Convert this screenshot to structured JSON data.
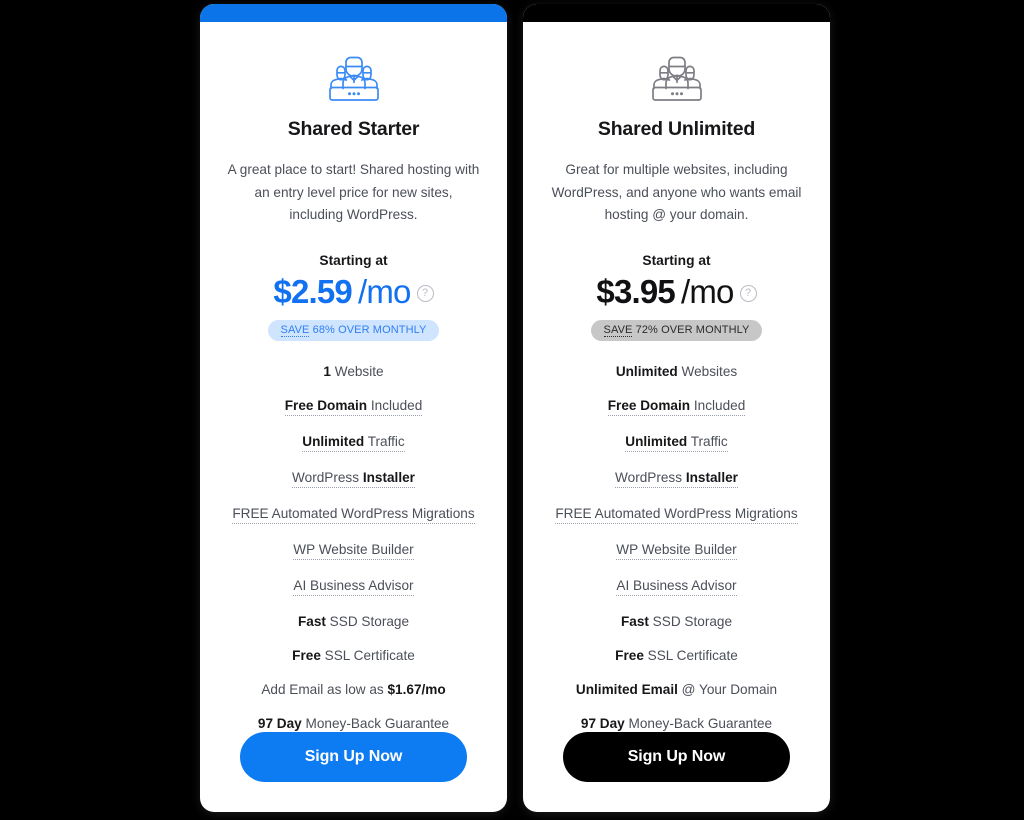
{
  "background_color": "#000000",
  "plans": [
    {
      "accent_color": "#1271f0",
      "topbar_color": "#0a74e8",
      "icon_name": "team-support-icon",
      "title": "Shared Starter",
      "description": "A great place to start! Shared hosting with an entry level price for new sites, including WordPress.",
      "starting_at_label": "Starting at",
      "price_amount": "$2.59",
      "price_period": "/mo",
      "help_icon": "question-mark-circle-icon",
      "save_badge": {
        "save_word": "SAVE",
        "rest": " 68% OVER MONTHLY",
        "background": "#cfe4ff",
        "text_color": "#2f7ff3"
      },
      "features": [
        {
          "bold": "1",
          "normal": " Website",
          "tooltip": false
        },
        {
          "bold": "Free Domain",
          "normal": " Included",
          "tooltip": true
        },
        {
          "bold": "Unlimited",
          "normal": " Traffic",
          "tooltip": true
        },
        {
          "bold": "",
          "normal": "WordPress ",
          "bold_after": "Installer",
          "tooltip": true
        },
        {
          "bold": "",
          "normal": "FREE Automated WordPress Migrations",
          "tooltip": true
        },
        {
          "bold": "",
          "normal": "WP Website Builder",
          "tooltip": true
        },
        {
          "bold": "",
          "normal": "AI Business Advisor",
          "tooltip": true
        },
        {
          "bold": "Fast",
          "normal": " SSD Storage",
          "tooltip": false
        },
        {
          "bold": "Free",
          "normal": " SSL Certificate",
          "tooltip": false
        },
        {
          "bold": "",
          "normal": "Add Email as low as ",
          "bold_after": "$1.67/mo",
          "tooltip": false
        },
        {
          "bold": "97 Day",
          "normal": " Money-Back Guarantee",
          "tooltip": false
        }
      ],
      "cta_label": "Sign Up Now",
      "cta_color": "#0d7bf2"
    },
    {
      "accent_color": "#111114",
      "topbar_color": "#000000",
      "icon_name": "team-support-icon",
      "title": "Shared Unlimited",
      "description": "Great for multiple websites, including WordPress, and anyone who wants email hosting @ your domain.",
      "starting_at_label": "Starting at",
      "price_amount": "$3.95",
      "price_period": "/mo",
      "help_icon": "question-mark-circle-icon",
      "save_badge": {
        "save_word": "SAVE",
        "rest": " 72% OVER MONTHLY",
        "background": "#c7c7c7",
        "text_color": "#2b2b2e"
      },
      "features": [
        {
          "bold": "Unlimited",
          "normal": " Websites",
          "tooltip": false
        },
        {
          "bold": "Free Domain",
          "normal": " Included",
          "tooltip": true
        },
        {
          "bold": "Unlimited",
          "normal": " Traffic",
          "tooltip": true
        },
        {
          "bold": "",
          "normal": "WordPress ",
          "bold_after": "Installer",
          "tooltip": true
        },
        {
          "bold": "",
          "normal": "FREE Automated WordPress Migrations",
          "tooltip": true
        },
        {
          "bold": "",
          "normal": "WP Website Builder",
          "tooltip": true
        },
        {
          "bold": "",
          "normal": "AI Business Advisor",
          "tooltip": true
        },
        {
          "bold": "Fast",
          "normal": " SSD Storage",
          "tooltip": false
        },
        {
          "bold": "Free",
          "normal": " SSL Certificate",
          "tooltip": false
        },
        {
          "bold": "Unlimited Email",
          "normal": " @ Your Domain",
          "tooltip": false
        },
        {
          "bold": "97 Day",
          "normal": " Money-Back Guarantee",
          "tooltip": false
        }
      ],
      "cta_label": "Sign Up Now",
      "cta_color": "#000000"
    }
  ]
}
